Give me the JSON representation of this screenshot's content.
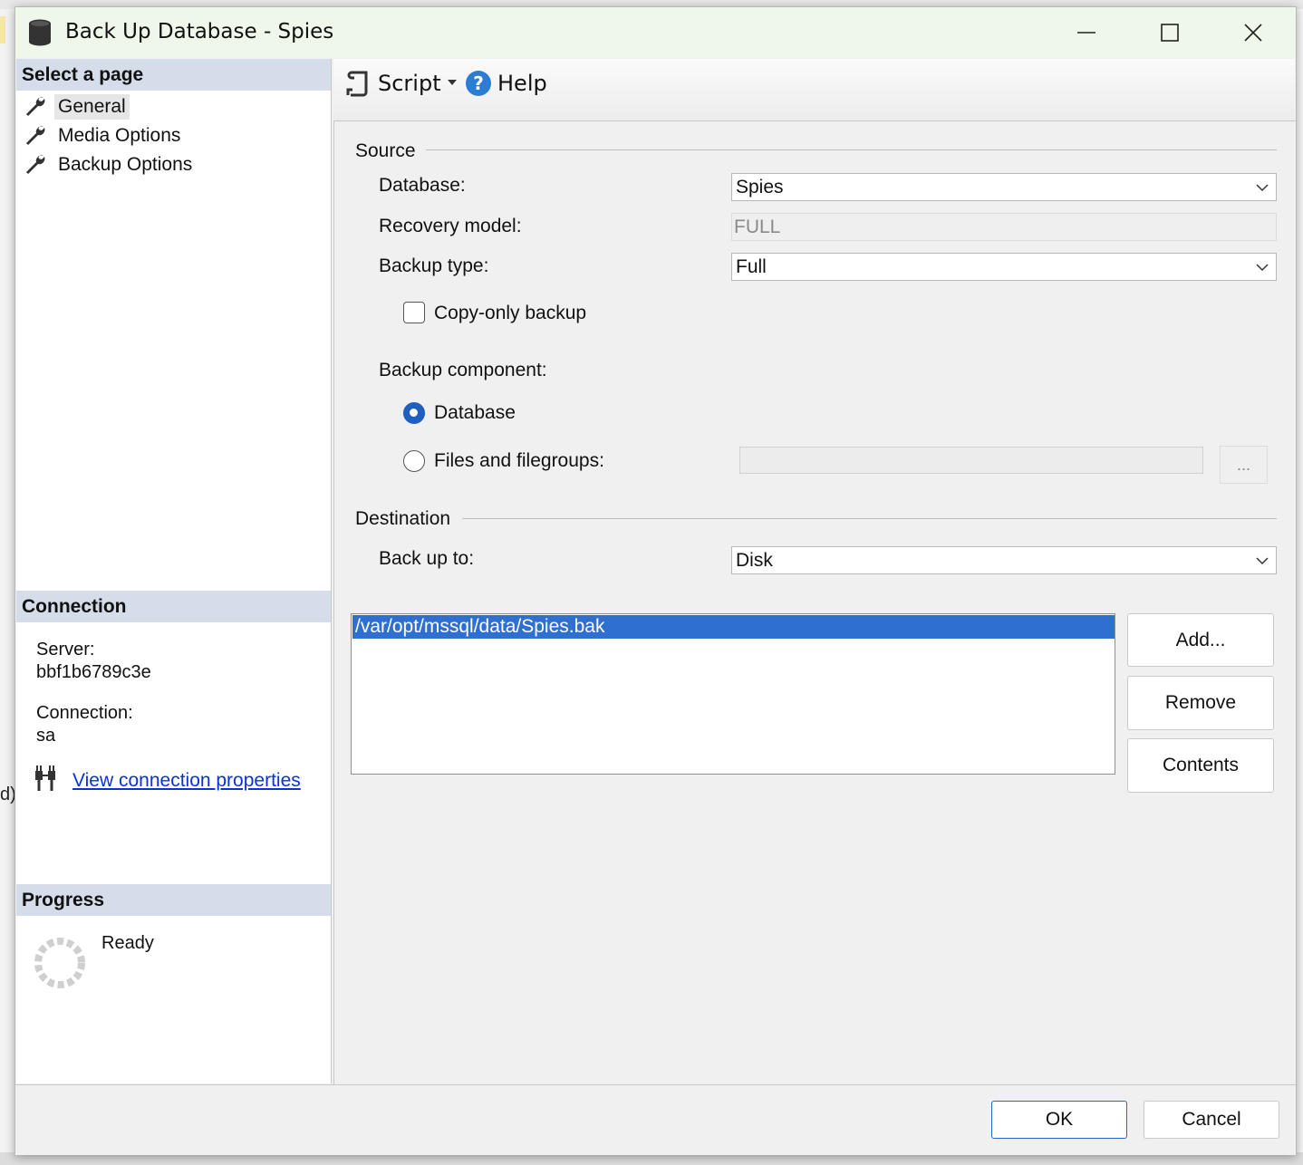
{
  "window": {
    "title": "Back Up Database - Spies"
  },
  "left": {
    "select_page_header": "Select a page",
    "pages": [
      {
        "label": "General"
      },
      {
        "label": "Media Options"
      },
      {
        "label": "Backup Options"
      }
    ],
    "connection_header": "Connection",
    "server_label": "Server:",
    "server_value": "bbf1b6789c3e",
    "connection_label": "Connection:",
    "connection_value": "sa",
    "view_connection_link": "View connection properties",
    "progress_header": "Progress",
    "progress_status": "Ready"
  },
  "toolbar": {
    "script_label": "Script",
    "help_label": "Help"
  },
  "source": {
    "group_label": "Source",
    "database_label": "Database:",
    "database_value": "Spies",
    "recovery_label": "Recovery model:",
    "recovery_value": "FULL",
    "backup_type_label": "Backup type:",
    "backup_type_value": "Full",
    "copy_only_label": "Copy-only backup",
    "copy_only_checked": false,
    "component_label": "Backup component:",
    "component_database_label": "Database",
    "component_files_label": "Files and filegroups:",
    "selected_component": "Database",
    "browse_label": "..."
  },
  "destination": {
    "group_label": "Destination",
    "backup_to_label": "Back up to:",
    "backup_to_value": "Disk",
    "paths": [
      "/var/opt/mssql/data/Spies.bak"
    ],
    "add_label": "Add...",
    "remove_label": "Remove",
    "contents_label": "Contents"
  },
  "footer": {
    "ok_label": "OK",
    "cancel_label": "Cancel"
  },
  "background": {
    "left_edge_text": "d)"
  }
}
